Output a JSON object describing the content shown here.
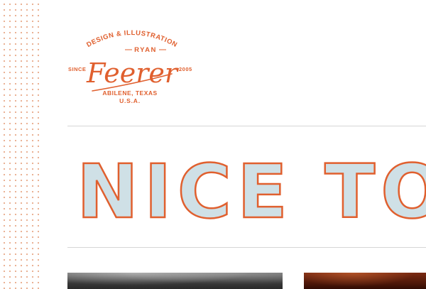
{
  "logo": {
    "top_arc": "DESIGN & ILLUSTRATION",
    "first_name": "RYAN",
    "script_name": "Feerer",
    "since_left": "SINCE",
    "since_right": "2005",
    "city": "ABILENE, TEXAS",
    "country": "U.S.A."
  },
  "headline": {
    "text": "NICE TO S"
  },
  "colors": {
    "accent": "#e0602f",
    "headline_fill": "#cfe0e6",
    "divider": "#d6d6d6",
    "dots": "#e8a98a"
  }
}
